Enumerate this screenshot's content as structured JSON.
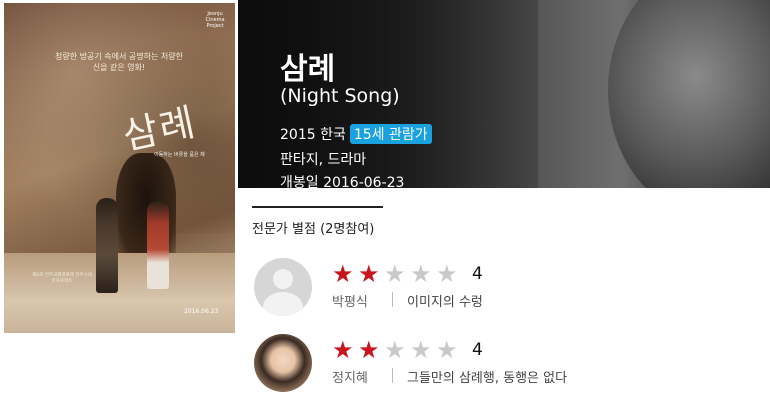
{
  "poster": {
    "logo_text": "Jeonju Cinema Project",
    "tagline": "청량한 방공기 속에서 공명하는 처량한 신을 같은 영화!",
    "title": "삼례",
    "subtitle": "이동하는 버릇을 품은 채",
    "laurels": "제6회 전주국제영화제 전주시네마프로젝트",
    "date": "2016.06.23"
  },
  "movie": {
    "title": "삼례",
    "original_title": "(Night Song)",
    "year_country": "2015 한국",
    "rating": "15세 관람가",
    "genre": "판타지, 드라마",
    "release": "개봉일 2016-06-23"
  },
  "critics": {
    "section_title": "전문가 별점 (2명참여)",
    "reviews": [
      {
        "name": "박평식",
        "score": "4",
        "filled_stars": 2,
        "total_stars": 5,
        "comment": "이미지의 수렁",
        "avatar": "default-avatar"
      },
      {
        "name": "정지혜",
        "score": "4",
        "filled_stars": 2,
        "total_stars": 5,
        "comment": "그들만의 삼례행, 동행은 없다",
        "avatar": "photo-avatar"
      }
    ]
  },
  "colors": {
    "star_on": "#c8161d",
    "star_off": "#c9c9c9",
    "rating_badge": "#1aa1e0"
  }
}
